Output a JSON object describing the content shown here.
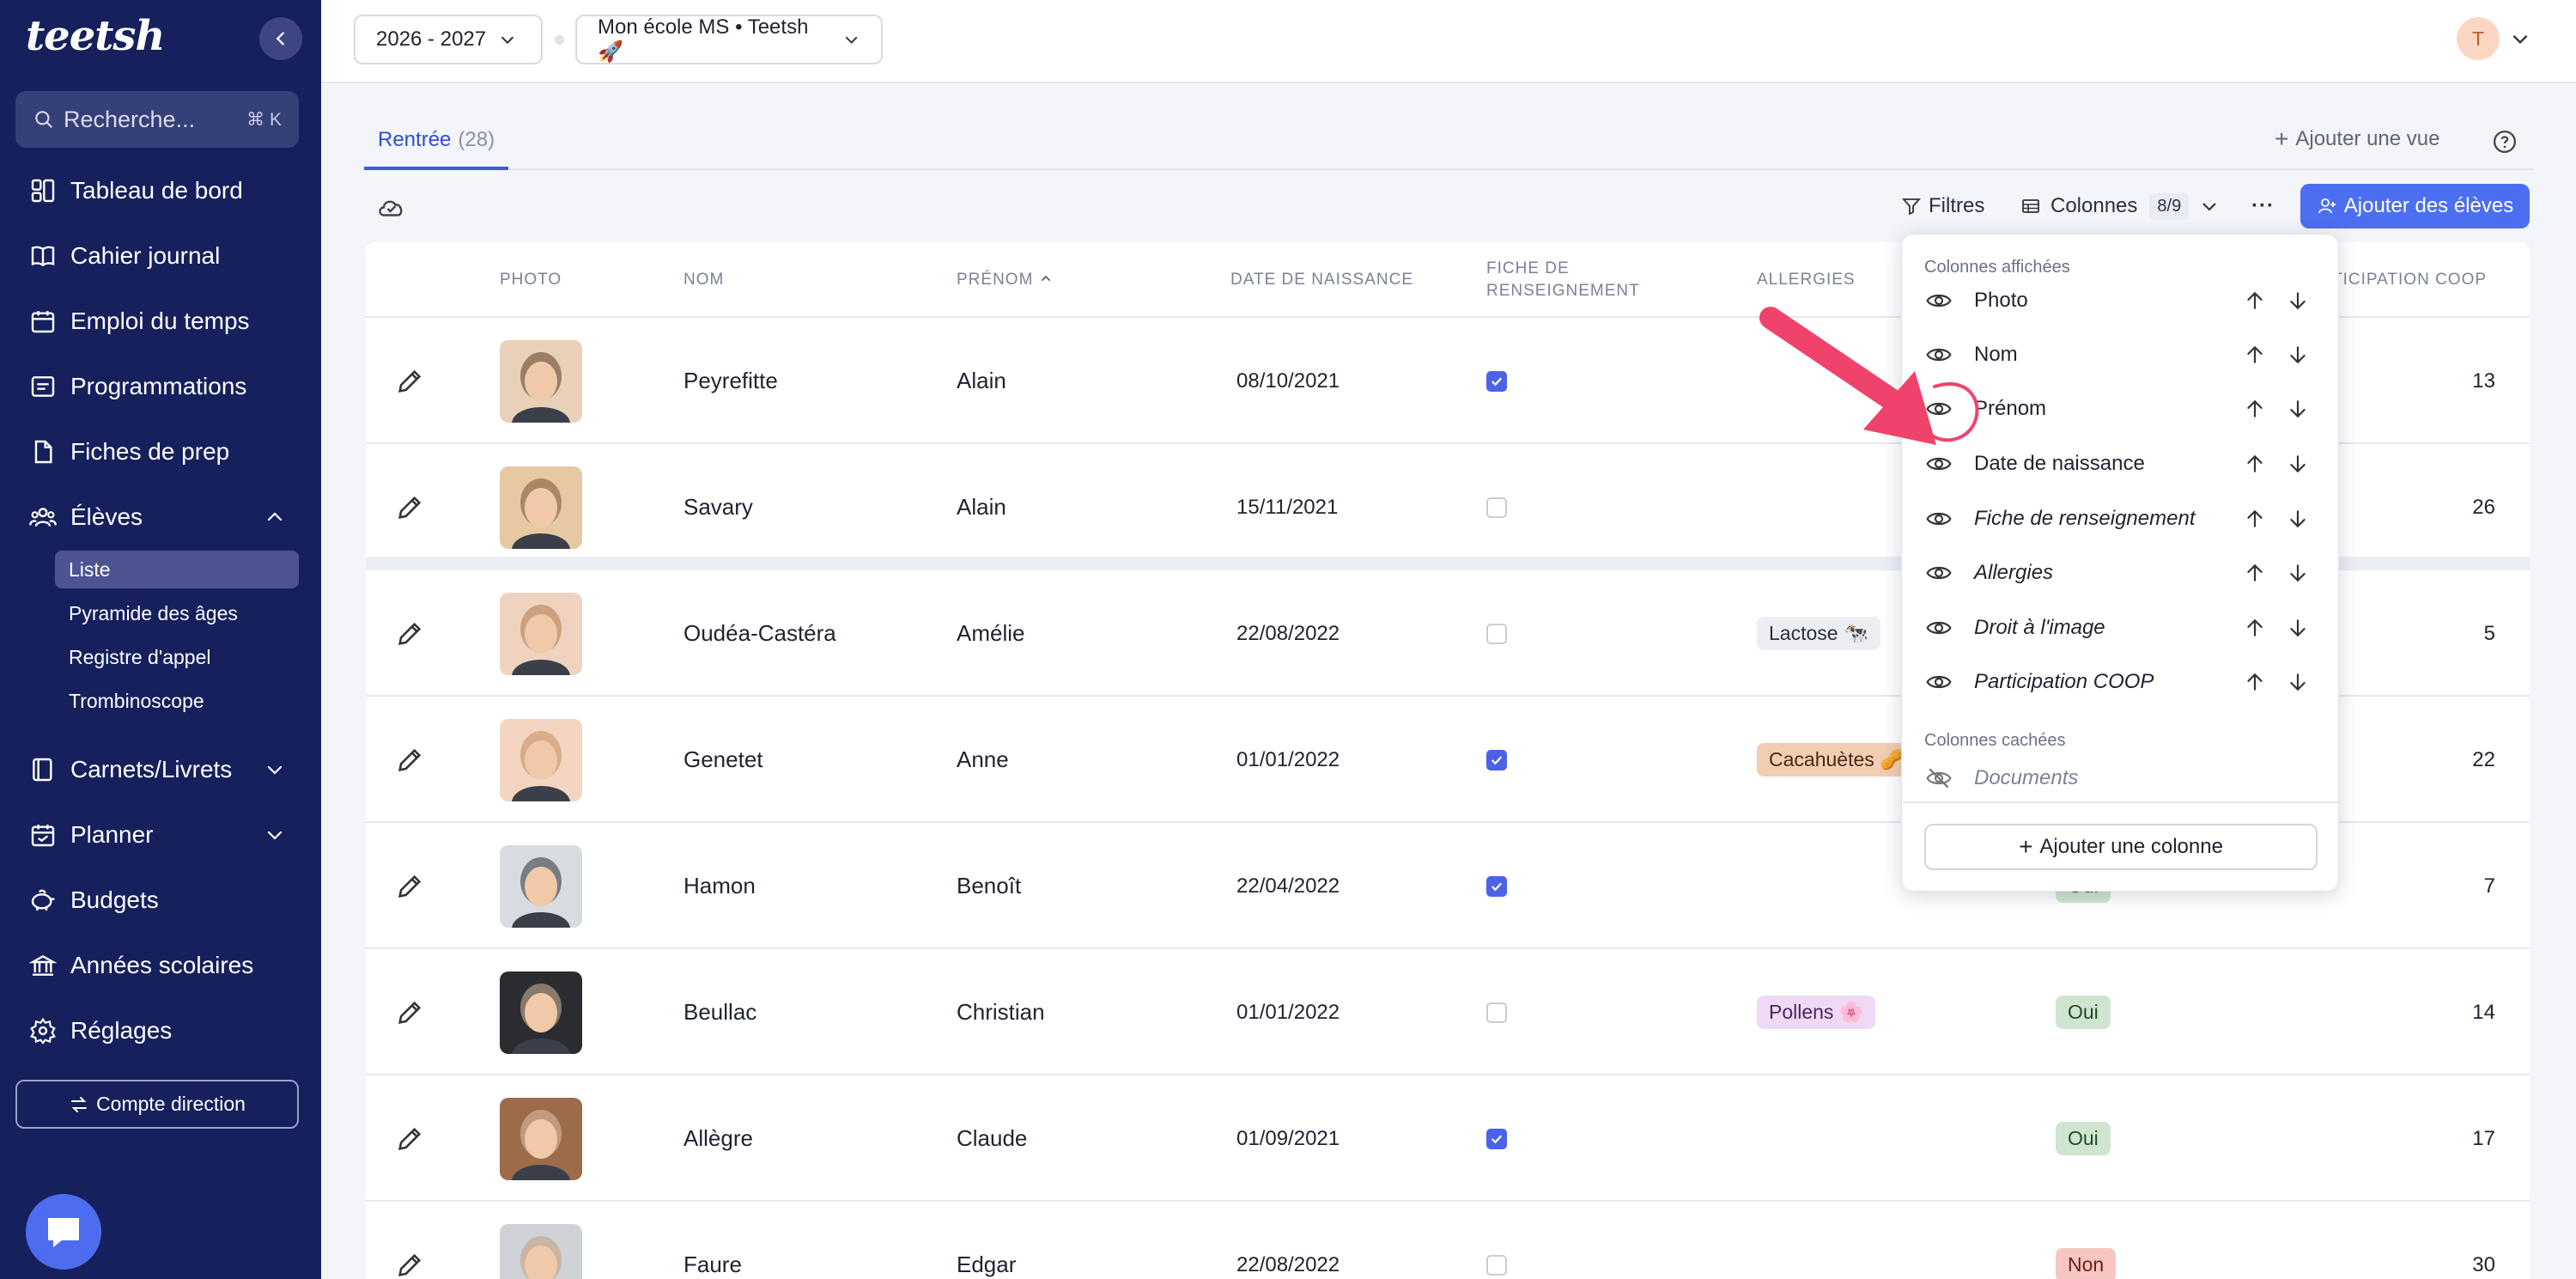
{
  "brand": {
    "logo_text": "teetsh"
  },
  "search": {
    "placeholder": "Recherche...",
    "shortcut": "⌘ K"
  },
  "sidebar": {
    "items": [
      {
        "label": "Tableau de bord",
        "icon": "dashboard-icon"
      },
      {
        "label": "Cahier journal",
        "icon": "book-icon"
      },
      {
        "label": "Emploi du temps",
        "icon": "calendar-icon"
      },
      {
        "label": "Programmations",
        "icon": "programmation-icon"
      },
      {
        "label": "Fiches de prep",
        "icon": "file-icon"
      },
      {
        "label": "Élèves",
        "icon": "students-icon"
      },
      {
        "label": "Carnets/Livrets",
        "icon": "notebook-icon"
      },
      {
        "label": "Planner",
        "icon": "planner-icon"
      },
      {
        "label": "Budgets",
        "icon": "piggy-bank-icon"
      },
      {
        "label": "Années scolaires",
        "icon": "school-icon"
      },
      {
        "label": "Réglages",
        "icon": "gear-icon"
      }
    ],
    "eleves_sub": [
      "Liste",
      "Pyramide des âges",
      "Registre d'appel",
      "Trombinoscope"
    ],
    "compte": "Compte direction"
  },
  "topbar": {
    "year": "2026 - 2027",
    "school": "Mon école MS • Teetsh 🚀",
    "avatar_initial": "T"
  },
  "tabs": {
    "active_label": "Rentrée",
    "active_count": "(28)",
    "add_view": "Ajouter une vue"
  },
  "toolbar": {
    "filters": "Filtres",
    "columns": "Colonnes",
    "columns_count": "8/9",
    "more": "···",
    "add_students": "Ajouter des élèves"
  },
  "table": {
    "headers": {
      "photo": "PHOTO",
      "nom": "NOM",
      "prenom": "PRÉNOM",
      "naissance": "DATE DE NAISSANCE",
      "fiche_1": "FICHE DE",
      "fiche_2": "RENSEIGNEMENT",
      "allergies": "ALLERGIES",
      "coop": "TICIPATION COOP"
    },
    "rows": [
      {
        "nom": "Peyrefitte",
        "prenom": "Alain",
        "naissance": "08/10/2021",
        "fiche": true,
        "allergie": "",
        "image": "",
        "coop": "13"
      },
      {
        "nom": "Savary",
        "prenom": "Alain",
        "naissance": "15/11/2021",
        "fiche": false,
        "allergie": "",
        "image": "",
        "coop": "26"
      },
      {
        "nom": "Oudéa-Castéra",
        "prenom": "Amélie",
        "naissance": "22/08/2022",
        "fiche": false,
        "allergie": "Lactose 🐄",
        "image": "",
        "coop": "5"
      },
      {
        "nom": "Genetet",
        "prenom": "Anne",
        "naissance": "01/01/2022",
        "fiche": true,
        "allergie": "Cacahuètes 🥜",
        "image": "",
        "coop": "22"
      },
      {
        "nom": "Hamon",
        "prenom": "Benoît",
        "naissance": "22/04/2022",
        "fiche": true,
        "allergie": "",
        "image": "Oui",
        "coop": "7"
      },
      {
        "nom": "Beullac",
        "prenom": "Christian",
        "naissance": "01/01/2022",
        "fiche": false,
        "allergie": "Pollens 🌸",
        "image": "Oui",
        "coop": "14"
      },
      {
        "nom": "Allègre",
        "prenom": "Claude",
        "naissance": "01/09/2021",
        "fiche": true,
        "allergie": "",
        "image": "Oui",
        "coop": "17"
      },
      {
        "nom": "Faure",
        "prenom": "Edgar",
        "naissance": "22/08/2022",
        "fiche": false,
        "allergie": "",
        "image": "Non",
        "coop": "30"
      }
    ]
  },
  "columns_menu": {
    "shown_title": "Colonnes affichées",
    "shown": [
      "Photo",
      "Nom",
      "Prénom",
      "Date de naissance",
      "Fiche de renseignement",
      "Allergies",
      "Droit à l'image",
      "Participation COOP"
    ],
    "hidden_title": "Colonnes cachées",
    "hidden": [
      "Documents"
    ],
    "add_column": "Ajouter une colonne"
  },
  "colors": {
    "sidebar": "#15205c",
    "accent": "#4c6ef0",
    "annotation": "#f0436b"
  }
}
